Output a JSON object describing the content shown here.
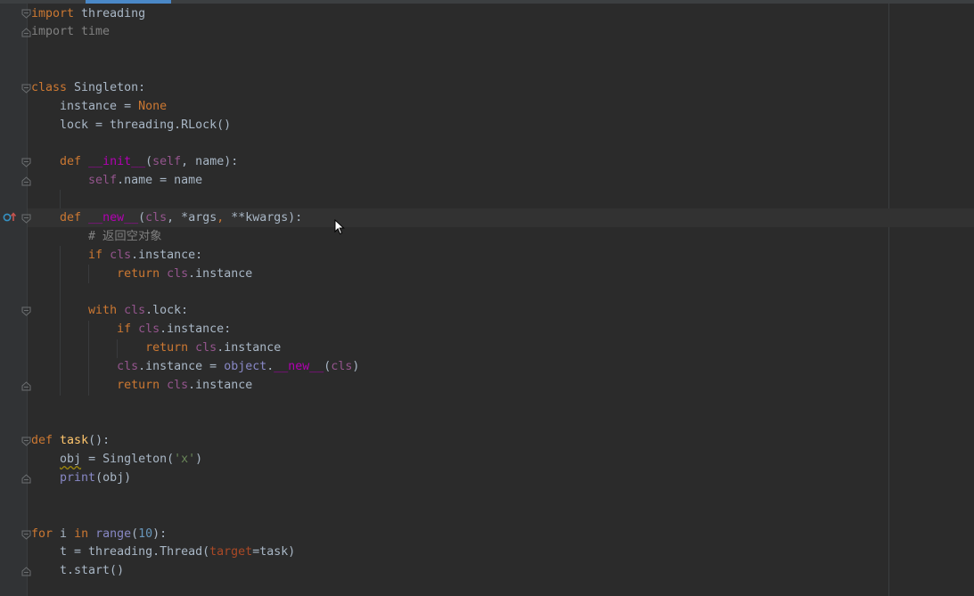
{
  "editor": {
    "lines": [
      {
        "tokens": [
          {
            "t": "import",
            "c": "kw"
          },
          {
            "t": " threading",
            "c": "name"
          }
        ]
      },
      {
        "tokens": [
          {
            "t": "import time",
            "c": "unused"
          }
        ]
      },
      {
        "tokens": []
      },
      {
        "tokens": []
      },
      {
        "tokens": [
          {
            "t": "class",
            "c": "kw"
          },
          {
            "t": " Singleton:",
            "c": "name"
          }
        ]
      },
      {
        "tokens": [
          {
            "t": "    instance = ",
            "c": "name"
          },
          {
            "t": "None",
            "c": "none"
          }
        ]
      },
      {
        "tokens": [
          {
            "t": "    lock = threading.RLock()",
            "c": "name"
          }
        ]
      },
      {
        "tokens": []
      },
      {
        "tokens": [
          {
            "t": "    ",
            "c": "name"
          },
          {
            "t": "def",
            "c": "kw"
          },
          {
            "t": " ",
            "c": "name"
          },
          {
            "t": "__init__",
            "c": "dunder"
          },
          {
            "t": "(",
            "c": "name"
          },
          {
            "t": "self",
            "c": "self"
          },
          {
            "t": ", name):",
            "c": "name"
          }
        ]
      },
      {
        "tokens": [
          {
            "t": "        ",
            "c": "name"
          },
          {
            "t": "self",
            "c": "self"
          },
          {
            "t": ".name = name",
            "c": "name"
          }
        ]
      },
      {
        "tokens": []
      },
      {
        "tokens": [
          {
            "t": "    ",
            "c": "name"
          },
          {
            "t": "def",
            "c": "kw"
          },
          {
            "t": " ",
            "c": "name"
          },
          {
            "t": "__new__",
            "c": "dunder"
          },
          {
            "t": "(",
            "c": "name"
          },
          {
            "t": "cls",
            "c": "self"
          },
          {
            "t": ", *args",
            "c": "name"
          },
          {
            "t": ",",
            "c": "kw"
          },
          {
            "t": " **kwargs):",
            "c": "name"
          }
        ]
      },
      {
        "tokens": [
          {
            "t": "        ",
            "c": "name"
          },
          {
            "t": "# 返回空对象",
            "c": "comment"
          }
        ]
      },
      {
        "tokens": [
          {
            "t": "        ",
            "c": "name"
          },
          {
            "t": "if",
            "c": "kw"
          },
          {
            "t": " ",
            "c": "name"
          },
          {
            "t": "cls",
            "c": "self"
          },
          {
            "t": ".instance:",
            "c": "name"
          }
        ]
      },
      {
        "tokens": [
          {
            "t": "            ",
            "c": "name"
          },
          {
            "t": "return",
            "c": "kw"
          },
          {
            "t": " ",
            "c": "name"
          },
          {
            "t": "cls",
            "c": "self"
          },
          {
            "t": ".instance",
            "c": "name"
          }
        ]
      },
      {
        "tokens": []
      },
      {
        "tokens": [
          {
            "t": "        ",
            "c": "name"
          },
          {
            "t": "with",
            "c": "kw"
          },
          {
            "t": " ",
            "c": "name"
          },
          {
            "t": "cls",
            "c": "self"
          },
          {
            "t": ".lock:",
            "c": "name"
          }
        ]
      },
      {
        "tokens": [
          {
            "t": "            ",
            "c": "name"
          },
          {
            "t": "if",
            "c": "kw"
          },
          {
            "t": " ",
            "c": "name"
          },
          {
            "t": "cls",
            "c": "self"
          },
          {
            "t": ".instance:",
            "c": "name"
          }
        ]
      },
      {
        "tokens": [
          {
            "t": "                ",
            "c": "name"
          },
          {
            "t": "return",
            "c": "kw"
          },
          {
            "t": " ",
            "c": "name"
          },
          {
            "t": "cls",
            "c": "self"
          },
          {
            "t": ".instance",
            "c": "name"
          }
        ]
      },
      {
        "tokens": [
          {
            "t": "            ",
            "c": "name"
          },
          {
            "t": "cls",
            "c": "self"
          },
          {
            "t": ".instance = ",
            "c": "name"
          },
          {
            "t": "object",
            "c": "builtin"
          },
          {
            "t": ".",
            "c": "name"
          },
          {
            "t": "__new__",
            "c": "dunder"
          },
          {
            "t": "(",
            "c": "name"
          },
          {
            "t": "cls",
            "c": "self"
          },
          {
            "t": ")",
            "c": "name"
          }
        ]
      },
      {
        "tokens": [
          {
            "t": "            ",
            "c": "name"
          },
          {
            "t": "return",
            "c": "kw"
          },
          {
            "t": " ",
            "c": "name"
          },
          {
            "t": "cls",
            "c": "self"
          },
          {
            "t": ".instance",
            "c": "name"
          }
        ]
      },
      {
        "tokens": []
      },
      {
        "tokens": []
      },
      {
        "tokens": [
          {
            "t": "def",
            "c": "kw"
          },
          {
            "t": " ",
            "c": "name"
          },
          {
            "t": "task",
            "c": "def"
          },
          {
            "t": "():",
            "c": "name"
          }
        ]
      },
      {
        "tokens": [
          {
            "t": "    ",
            "c": "name"
          },
          {
            "t": "obj",
            "c": "warn"
          },
          {
            "t": " = Singleton(",
            "c": "name"
          },
          {
            "t": "'x'",
            "c": "str"
          },
          {
            "t": ")",
            "c": "name"
          }
        ]
      },
      {
        "tokens": [
          {
            "t": "    ",
            "c": "name"
          },
          {
            "t": "print",
            "c": "builtin"
          },
          {
            "t": "(obj)",
            "c": "name"
          }
        ]
      },
      {
        "tokens": []
      },
      {
        "tokens": []
      },
      {
        "tokens": [
          {
            "t": "for",
            "c": "kw"
          },
          {
            "t": " i ",
            "c": "name"
          },
          {
            "t": "in",
            "c": "kw"
          },
          {
            "t": " ",
            "c": "name"
          },
          {
            "t": "range",
            "c": "builtin"
          },
          {
            "t": "(",
            "c": "name"
          },
          {
            "t": "10",
            "c": "num"
          },
          {
            "t": "):",
            "c": "name"
          }
        ]
      },
      {
        "tokens": [
          {
            "t": "    t = threading.Thread(",
            "c": "name"
          },
          {
            "t": "target",
            "c": "param"
          },
          {
            "t": "=task)",
            "c": "name"
          }
        ]
      },
      {
        "tokens": [
          {
            "t": "    t.start()",
            "c": "name"
          }
        ]
      }
    ],
    "gutter_marker": "overrides-method-icon",
    "colors": {
      "background": "#2b2b2b",
      "gutter": "#313335",
      "keyword": "#cc7832",
      "function_name": "#ffc66d",
      "dunder": "#b200b2",
      "self_cls": "#94558d",
      "string": "#6a8759",
      "number": "#6897bb",
      "builtin": "#8888c6",
      "comment": "#808080",
      "default": "#a9b7c6"
    }
  }
}
